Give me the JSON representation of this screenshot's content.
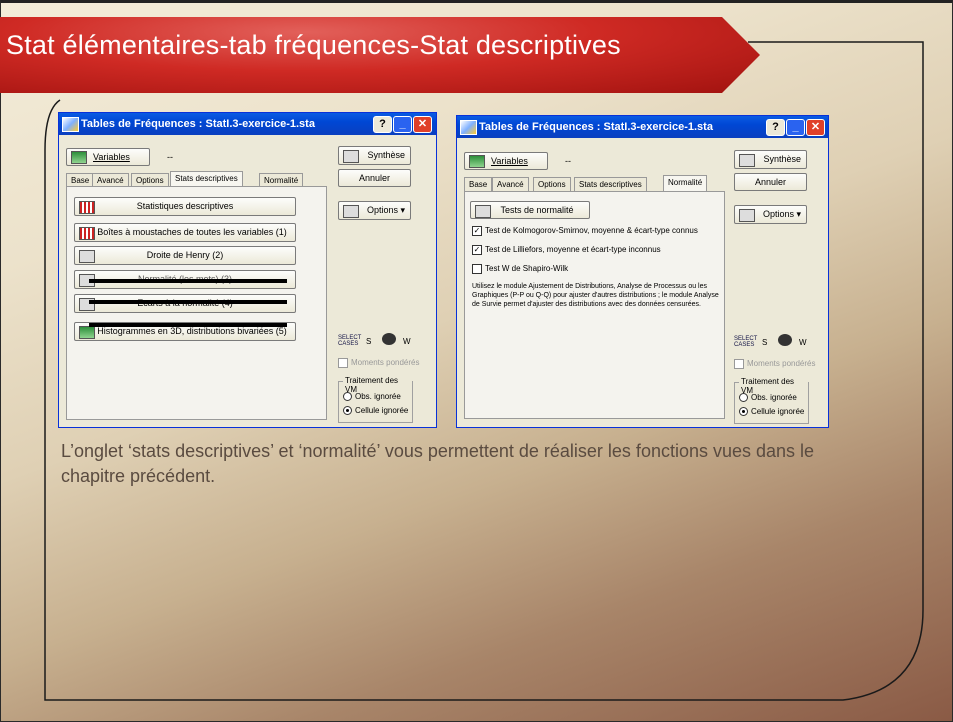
{
  "slide": {
    "title": "Stat élémentaires-tab fréquences-Stat descriptives",
    "body_text": "L’onglet ‘stats descriptives’ et ‘normalité’ vous permettent de réaliser les fonctions vues dans le chapitre précédent."
  },
  "dialog_left": {
    "title": "Tables de Fréquences : StatI.3-exercice-1.sta",
    "help": "?",
    "minimize": "_",
    "close": "✕",
    "variables": "Variables",
    "variables_value": "--",
    "synthese": "Synthèse",
    "annuler": "Annuler",
    "options": "Options",
    "tabs": [
      "Base",
      "Avancé",
      "Options",
      "Stats descriptives",
      "Normalité"
    ],
    "active_tab": "Stats descriptives",
    "buttons": [
      "Statistiques descriptives",
      "Boîtes à moustaches de toutes les variables (1)",
      "Droite de Henry (2)",
      "Normalité (les mots) (3)",
      "Ecarts à la normalité (4)",
      "Histogrammes en 3D, distributions bivariées (5)"
    ],
    "select_cases": "SELECT CASES",
    "s_label": "S",
    "w_label": "W",
    "moments": "Moments pondérés",
    "traitement": "Traitement des VM",
    "obs": "Obs. ignorée",
    "cellule": "Cellule ignorée"
  },
  "dialog_right": {
    "title": "Tables de Fréquences : StatI.3-exercice-1.sta",
    "help": "?",
    "minimize": "_",
    "close": "✕",
    "variables": "Variables",
    "variables_value": "--",
    "synthese": "Synthèse",
    "annuler": "Annuler",
    "options": "Options",
    "tabs": [
      "Base",
      "Avancé",
      "Options",
      "Stats descriptives",
      "Normalité"
    ],
    "active_tab": "Normalité",
    "tests_button": "Tests de normalité",
    "check1": "Test de Kolmogorov-Smirnov, moyenne & écart-type connus",
    "check2": "Test de Lilliefors, moyenne et écart-type inconnus",
    "check3": "Test W de Shapiro-Wilk",
    "check1_on": true,
    "check2_on": true,
    "check3_on": false,
    "info": "Utilisez le module Ajustement de Distributions, Analyse de Processus ou les Graphiques (P-P ou Q-Q) pour ajuster d'autres distributions ; le module Analyse de Survie permet d'ajuster des distributions avec des données censurées.",
    "select_cases": "SELECT CASES",
    "s_label": "S",
    "w_label": "W",
    "moments": "Moments pondérés",
    "traitement": "Traitement des VM",
    "obs": "Obs. ignorée",
    "cellule": "Cellule ignorée"
  },
  "colors": {
    "banner": "#cf2a24",
    "titlebar": "#0047d4",
    "body_text": "#5a4b40"
  }
}
